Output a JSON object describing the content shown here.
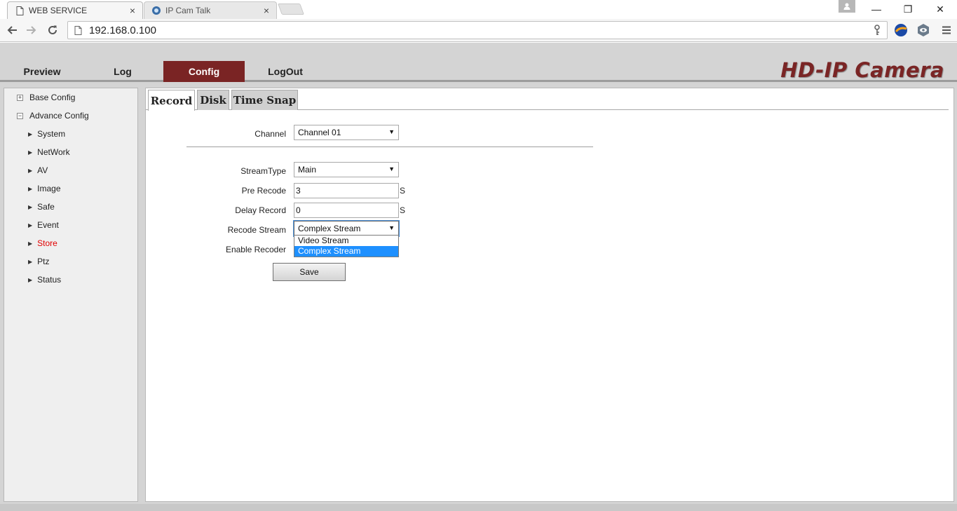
{
  "browser": {
    "tabs": [
      {
        "label": "WEB SERVICE",
        "close": "×"
      },
      {
        "label": "IP Cam Talk",
        "close": "×"
      }
    ],
    "url": "192.168.0.100",
    "window": {
      "minimize": "—",
      "restore": "❐",
      "close": "✕"
    }
  },
  "nav": {
    "items": [
      {
        "label": "Preview"
      },
      {
        "label": "Log"
      },
      {
        "label": "Config"
      },
      {
        "label": "LogOut"
      }
    ],
    "active": "Config",
    "brand": "HD-IP Camera",
    "active_color": "#7a2424"
  },
  "sidebar": {
    "groups": [
      {
        "label": "Base Config",
        "expander": "+"
      },
      {
        "label": "Advance Config",
        "expander": "−"
      }
    ],
    "items": [
      {
        "label": "System"
      },
      {
        "label": "NetWork"
      },
      {
        "label": "AV"
      },
      {
        "label": "Image"
      },
      {
        "label": "Safe"
      },
      {
        "label": "Event"
      },
      {
        "label": "Store"
      },
      {
        "label": "Ptz"
      },
      {
        "label": "Status"
      }
    ],
    "active": "Store",
    "active_color": "#e00000"
  },
  "subtabs": [
    {
      "label": "Record"
    },
    {
      "label": "Disk"
    },
    {
      "label": "Time Snap"
    }
  ],
  "form": {
    "channel": {
      "label": "Channel",
      "value": "Channel 01"
    },
    "stream_type": {
      "label": "StreamType",
      "value": "Main"
    },
    "pre_record": {
      "label": "Pre Recode",
      "value": "3",
      "unit": "S"
    },
    "delay_record": {
      "label": "Delay Record",
      "value": "0",
      "unit": "S"
    },
    "record_stream": {
      "label": "Recode Stream",
      "value": "Complex Stream",
      "options": [
        "Video Stream",
        "Complex Stream"
      ],
      "highlighted": "Complex Stream"
    },
    "enable_recorder": {
      "label": "Enable Recoder"
    },
    "save_label": "Save"
  }
}
